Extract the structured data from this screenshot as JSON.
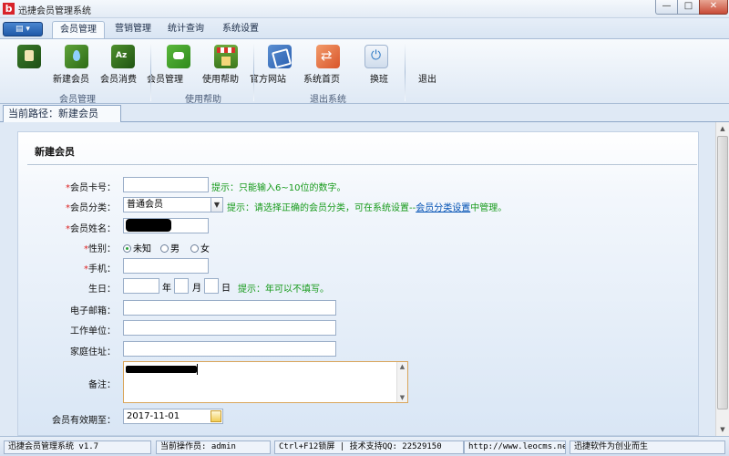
{
  "window": {
    "logo": "b",
    "title": "迅捷会员管理系统",
    "min_label": "—",
    "max_label": "□",
    "close_label": "✕"
  },
  "appmenu": {
    "label": "▤ ▾"
  },
  "tabs": [
    {
      "label": "会员管理",
      "active": true
    },
    {
      "label": "营销管理",
      "active": false
    },
    {
      "label": "统计查询",
      "active": false
    },
    {
      "label": "系统设置",
      "active": false
    }
  ],
  "ribbon": {
    "groups": [
      {
        "label": "会员管理"
      },
      {
        "label": "使用帮助"
      },
      {
        "label": "退出系统"
      }
    ],
    "buttons": [
      {
        "label": "新建会员",
        "icon": "member-book-icon"
      },
      {
        "label": "会员消费",
        "icon": "drop-icon"
      },
      {
        "label": "会员管理",
        "icon": "az-book-icon"
      },
      {
        "label": "使用帮助",
        "icon": "chat-bubble-icon"
      },
      {
        "label": "官方网站",
        "icon": "shop-icon"
      },
      {
        "label": "系统首页",
        "icon": "home-icon"
      },
      {
        "label": "换班",
        "icon": "swap-icon"
      },
      {
        "label": "退出",
        "icon": "power-icon"
      }
    ]
  },
  "breadcrumb": {
    "text": "当前路径：新建会员"
  },
  "form": {
    "title": "新建会员",
    "fields": {
      "card_no": {
        "label": "会员卡号：",
        "required_mark": "*",
        "value": "",
        "hint": "提示：只能输入6~10位的数字。"
      },
      "category": {
        "label": "会员分类：",
        "required_mark": "*",
        "value": "普通会员",
        "hint_prefix": "提示：请选择正确的会员分类，可在系统设置--",
        "hint_link": "会员分类设置",
        "hint_suffix": "中管理。"
      },
      "name": {
        "label": "会员姓名：",
        "required_mark": "*",
        "value": ""
      },
      "gender": {
        "label": "性别：",
        "required_mark": "*",
        "options": [
          "未知",
          "男",
          "女"
        ],
        "selected": "未知"
      },
      "phone": {
        "label": "手机：",
        "required_mark": "*",
        "value": ""
      },
      "birthday": {
        "label": "生日：",
        "year_unit": "年",
        "month_unit": "月",
        "day_unit": "日",
        "hint": "提示：年可以不填写。"
      },
      "email": {
        "label": "电子邮箱：",
        "value": ""
      },
      "work": {
        "label": "工作单位：",
        "value": ""
      },
      "address": {
        "label": "家庭住址：",
        "value": ""
      },
      "remark": {
        "label": "备注：",
        "value": ""
      },
      "expiry": {
        "label": "会员有效期至：",
        "value": "2017-11-01"
      }
    }
  },
  "statusbar": {
    "app": "迅捷会员管理系统 v1.7",
    "operator": "当前操作员: admin",
    "support": "Ctrl+F12锁屏 | 技术支持QQ: 22529150",
    "url": "http://www.leocms.net",
    "slogan": "迅捷软件为创业而生"
  },
  "colors": {
    "required": "#dd2222",
    "hint": "#169a1a",
    "link": "#0050b4",
    "accent": "#1f59a8"
  }
}
